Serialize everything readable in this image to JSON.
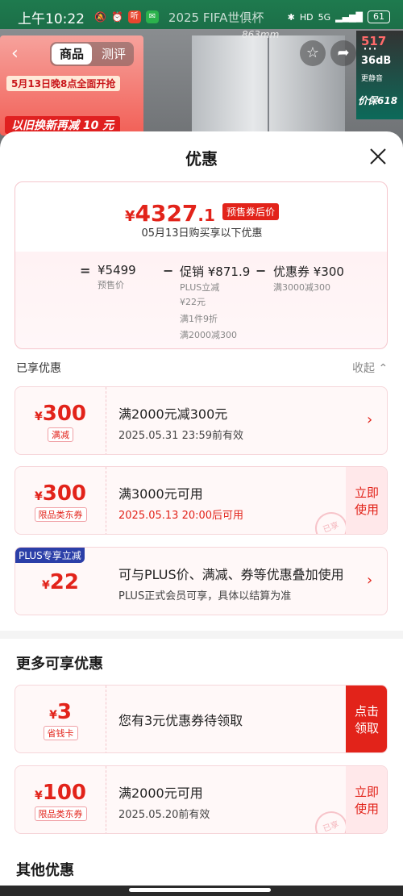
{
  "status_bar": {
    "time": "上午10:22",
    "ad_text": "2025 FIFA世俱杯",
    "network": "5G",
    "battery": "61"
  },
  "background": {
    "banner_promo1": "5月13日晚8点全面开抢",
    "banner_promo2": "以旧换新再减 10 元",
    "dimension": "863mm",
    "side_1": "517",
    "side_2": "36dB",
    "side_3": "更静音",
    "side_4": "价保618"
  },
  "top_nav": {
    "tabs": [
      "商品",
      "测评"
    ]
  },
  "sheet": {
    "title": "优惠",
    "summary": {
      "currency": "¥",
      "price_int": "4327",
      "price_dec": ".1",
      "price_tag": "预售券后价",
      "subtitle": "05月13日购买享以下优惠",
      "presale_value": "¥5499",
      "presale_label": "预售价",
      "promo_value": "促销 ¥871.9",
      "promo_details": [
        "PLUS立减",
        "¥22元",
        "满1件9折",
        "满2000减300"
      ],
      "coupon_value": "优惠券 ¥300",
      "coupon_detail": "满3000减300",
      "eq": "=",
      "minus": "−"
    },
    "enjoyed_header": "已享优惠",
    "collapse_label": "收起",
    "enjoyed": [
      {
        "amount": "300",
        "badge": "满减",
        "title": "满2000元减300元",
        "subtitle": "2025.05.31 23:59前有效"
      },
      {
        "amount": "300",
        "badge": "限品类东券",
        "title": "满3000元可用",
        "subtitle": "2025.05.13 20:00后可用",
        "action": [
          "立即",
          "使用"
        ],
        "stamp": "已享"
      },
      {
        "amount": "22",
        "plus_tag": "PLUS专享立减",
        "title": "可与PLUS价、满减、券等优惠叠加使用",
        "subtitle": "PLUS正式会员可享，具体以结算为准"
      }
    ],
    "more_title": "更多可享优惠",
    "more": [
      {
        "amount": "3",
        "badge": "省钱卡",
        "title": "您有3元优惠券待领取",
        "action": [
          "点击",
          "领取"
        ]
      },
      {
        "amount": "100",
        "badge": "限品类东券",
        "title": "满2000元可用",
        "subtitle": "2025.05.20前有效",
        "action": [
          "立即",
          "使用"
        ],
        "stamp": "已享"
      }
    ],
    "other_title": "其他优惠"
  },
  "colors": {
    "accent_red": "#e2231a",
    "plus_blue": "#2b3fa8"
  }
}
